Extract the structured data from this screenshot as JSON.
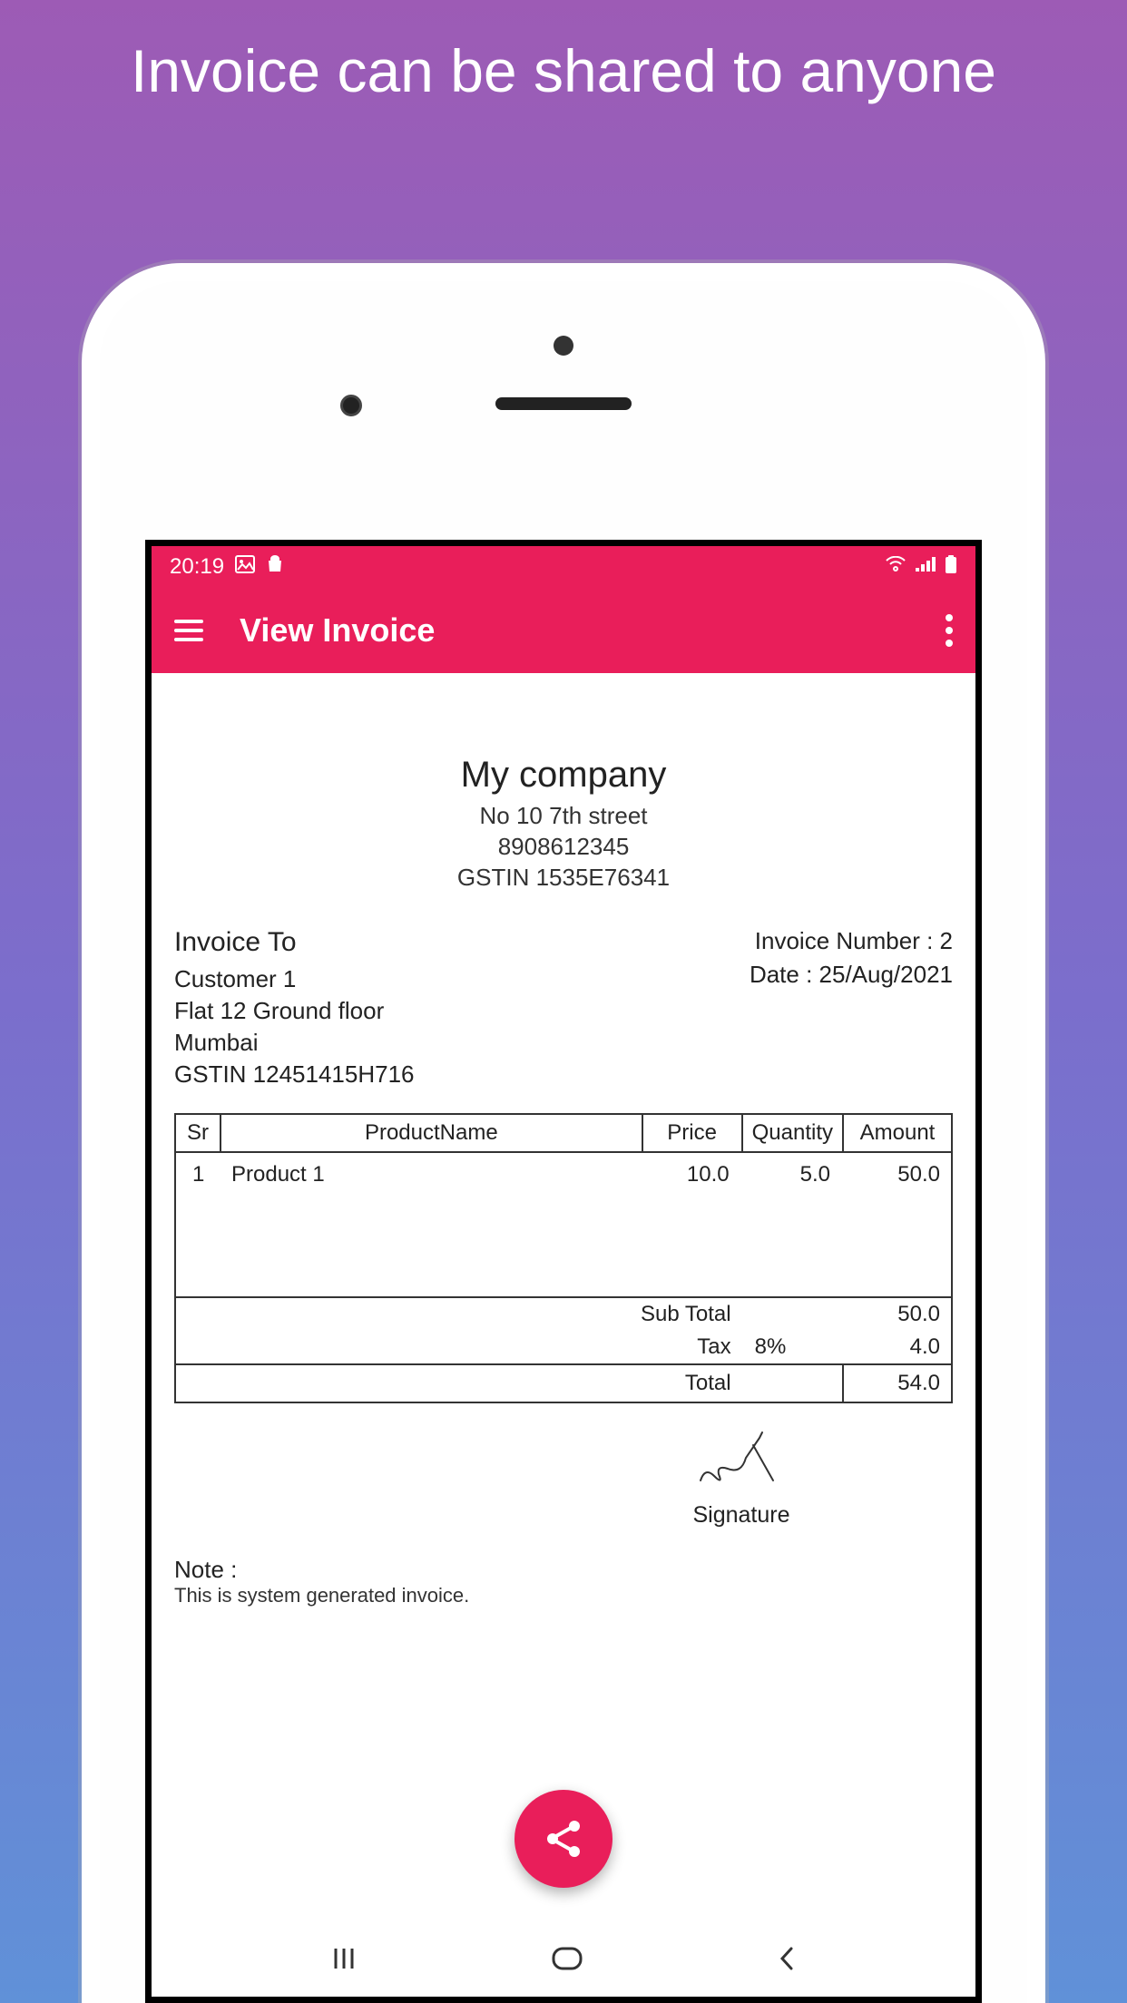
{
  "promo": {
    "title": "Invoice can be shared to anyone"
  },
  "statusBar": {
    "time": "20:19"
  },
  "appBar": {
    "title": "View Invoice"
  },
  "company": {
    "name": "My company",
    "address": "No 10 7th street",
    "phone": "8908612345",
    "gstin": "GSTIN 1535E76341"
  },
  "invoiceTo": {
    "label": "Invoice To",
    "customer": "Customer 1",
    "address1": "Flat 12 Ground floor",
    "city": "Mumbai",
    "gstin": "GSTIN 12451415H716"
  },
  "invoiceMeta": {
    "numberLabel": "Invoice Number : 2",
    "dateLabel": "Date : 25/Aug/2021"
  },
  "table": {
    "headers": {
      "sr": "Sr",
      "name": "ProductName",
      "price": "Price",
      "qty": "Quantity",
      "amt": "Amount"
    },
    "row": {
      "sr": "1",
      "name": "Product 1",
      "price": "10.0",
      "qty": "5.0",
      "amt": "50.0"
    },
    "subtotal": {
      "label": "Sub Total",
      "value": "50.0"
    },
    "tax": {
      "label": "Tax",
      "rate": "8%",
      "value": "4.0"
    },
    "total": {
      "label": "Total",
      "value": "54.0"
    }
  },
  "signature": {
    "label": "Signature"
  },
  "note": {
    "label": "Note :",
    "text": "This is system generated invoice."
  }
}
